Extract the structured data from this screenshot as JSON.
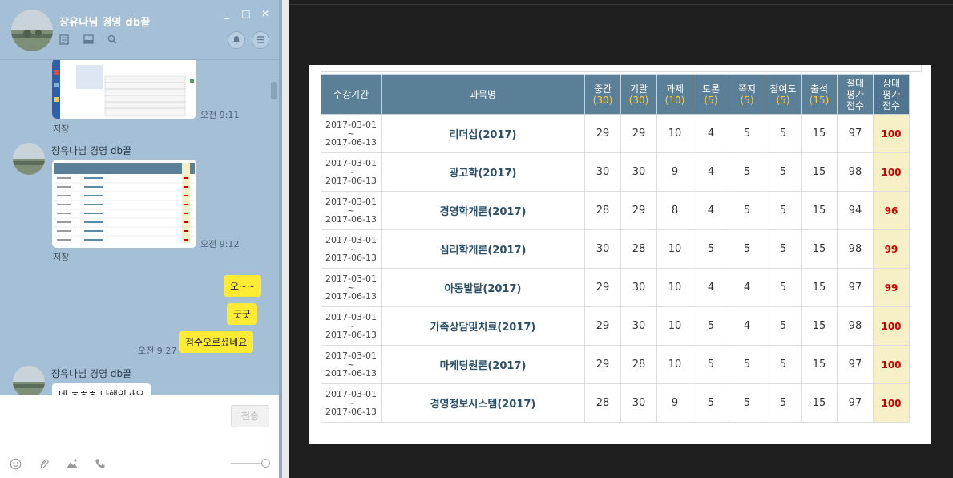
{
  "chat": {
    "title": "장유나님 경영 db끝",
    "window_controls": [
      "_",
      "□",
      "✕"
    ],
    "messages": [
      {
        "type": "image",
        "time": "오전 9:11",
        "save": "저장"
      },
      {
        "type": "image",
        "sender": "장유나님 경영 db끝",
        "time": "오전 9:12",
        "save": "저장"
      },
      {
        "type": "me",
        "text": "오~~"
      },
      {
        "type": "me",
        "text": "굿굿"
      },
      {
        "type": "me",
        "text": "점수오르셨네요",
        "time": "오전 9:27"
      },
      {
        "type": "other",
        "sender": "장유나님 경영 db끝",
        "text": "네 ㅎㅎㅎ 다행인가요"
      }
    ],
    "send_label": "전송"
  },
  "table": {
    "headers": {
      "period": "수강기간",
      "subject": "과목명",
      "mid": {
        "label": "중간",
        "pts": "(30)"
      },
      "final": {
        "label": "기말",
        "pts": "(30)"
      },
      "assign": {
        "label": "과제",
        "pts": "(10)"
      },
      "discuss": {
        "label": "토론",
        "pts": "(5)"
      },
      "quiz": {
        "label": "쪽지",
        "pts": "(5)"
      },
      "partic": {
        "label": "참여도",
        "pts": "(5)"
      },
      "attend": {
        "label": "출석",
        "pts": "(15)"
      },
      "abs": [
        "절대",
        "평가",
        "점수"
      ],
      "rel": [
        "상대",
        "평가",
        "점수"
      ]
    },
    "rows": [
      {
        "start": "2017-03-01",
        "tilde": "~",
        "end": "2017-06-13",
        "subject": "리더십(2017)",
        "mid": "29",
        "final": "29",
        "assign": "10",
        "discuss": "4",
        "quiz": "5",
        "partic": "5",
        "attend": "15",
        "abs": "97",
        "rel": "100"
      },
      {
        "start": "2017-03-01",
        "tilde": "~",
        "end": "2017-06-13",
        "subject": "광고학(2017)",
        "mid": "30",
        "final": "30",
        "assign": "9",
        "discuss": "4",
        "quiz": "5",
        "partic": "5",
        "attend": "15",
        "abs": "98",
        "rel": "100"
      },
      {
        "start": "2017-03-01",
        "tilde": "~",
        "end": "2017-06-13",
        "subject": "경영학개론(2017)",
        "mid": "28",
        "final": "29",
        "assign": "8",
        "discuss": "4",
        "quiz": "5",
        "partic": "5",
        "attend": "15",
        "abs": "94",
        "rel": "96"
      },
      {
        "start": "2017-03-01",
        "tilde": "~",
        "end": "2017-06-13",
        "subject": "심리학개론(2017)",
        "mid": "30",
        "final": "28",
        "assign": "10",
        "discuss": "5",
        "quiz": "5",
        "partic": "5",
        "attend": "15",
        "abs": "98",
        "rel": "99"
      },
      {
        "start": "2017-03-01",
        "tilde": "~",
        "end": "2017-06-13",
        "subject": "아동발달(2017)",
        "mid": "29",
        "final": "30",
        "assign": "10",
        "discuss": "4",
        "quiz": "4",
        "partic": "5",
        "attend": "15",
        "abs": "97",
        "rel": "99"
      },
      {
        "start": "2017-03-01",
        "tilde": "~",
        "end": "2017-06-13",
        "subject": "가족상담및치료(2017)",
        "mid": "29",
        "final": "30",
        "assign": "10",
        "discuss": "5",
        "quiz": "4",
        "partic": "5",
        "attend": "15",
        "abs": "98",
        "rel": "100"
      },
      {
        "start": "2017-03-01",
        "tilde": "~",
        "end": "2017-06-13",
        "subject": "마케팅원론(2017)",
        "mid": "29",
        "final": "28",
        "assign": "10",
        "discuss": "5",
        "quiz": "5",
        "partic": "5",
        "attend": "15",
        "abs": "97",
        "rel": "100"
      },
      {
        "start": "2017-03-01",
        "tilde": "~",
        "end": "2017-06-13",
        "subject": "경영정보시스템(2017)",
        "mid": "28",
        "final": "30",
        "assign": "9",
        "discuss": "5",
        "quiz": "5",
        "partic": "5",
        "attend": "15",
        "abs": "97",
        "rel": "100"
      }
    ]
  }
}
